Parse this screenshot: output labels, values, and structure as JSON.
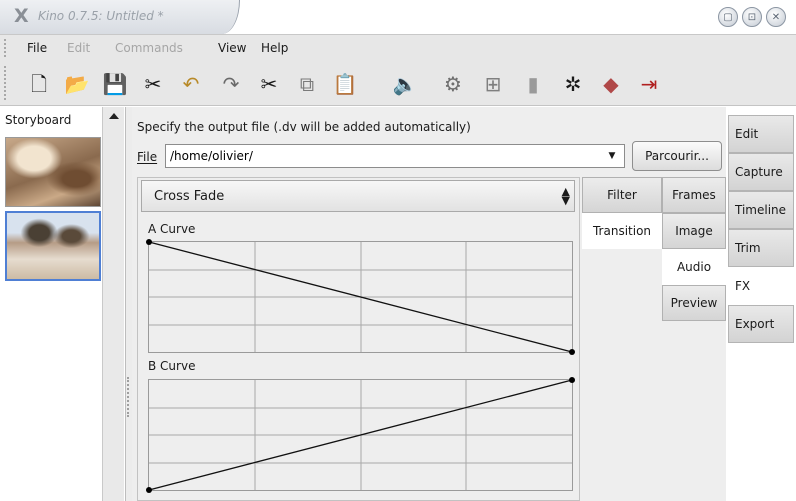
{
  "window": {
    "title": "Kino 0.7.5: Untitled *",
    "logo_glyph": "X",
    "controls": [
      {
        "name": "minimize",
        "glyph": "▢"
      },
      {
        "name": "maximize",
        "glyph": "⊡"
      },
      {
        "name": "close",
        "glyph": "✕"
      }
    ]
  },
  "menu": {
    "items": [
      {
        "label": "File",
        "enabled": true
      },
      {
        "label": "Edit",
        "enabled": false
      },
      {
        "label": "Commands",
        "enabled": false
      },
      {
        "label": "View",
        "enabled": true
      },
      {
        "label": "Help",
        "enabled": true
      }
    ]
  },
  "toolbar": {
    "icons": [
      {
        "name": "new-file-icon",
        "glyph": "🗋"
      },
      {
        "name": "open-folder-icon",
        "glyph": "📂"
      },
      {
        "name": "save-icon",
        "glyph": "💾"
      },
      {
        "name": "tools-icon",
        "glyph": "✂"
      },
      {
        "name": "undo-icon",
        "glyph": "↶"
      },
      {
        "name": "redo-icon",
        "glyph": "↷"
      },
      {
        "name": "cut-icon",
        "glyph": "✂"
      },
      {
        "name": "copy-icon",
        "glyph": "⧉"
      },
      {
        "name": "paste-icon",
        "glyph": "📋"
      },
      {
        "name": "speaker-icon",
        "glyph": "🔈"
      },
      {
        "name": "capture-icon",
        "glyph": "⚙"
      },
      {
        "name": "scene-icon",
        "glyph": "⊞"
      },
      {
        "name": "clip-icon",
        "glyph": "▮"
      },
      {
        "name": "properties-icon",
        "glyph": "✲"
      },
      {
        "name": "eraser-icon",
        "glyph": "◆"
      },
      {
        "name": "exit-icon",
        "glyph": "⇥"
      }
    ],
    "colors": {
      "save": "#4a7bb8",
      "undo": "#b88a28",
      "exit": "#b02020",
      "eraser": "#b04848"
    }
  },
  "storyboard": {
    "label": "Storyboard"
  },
  "export": {
    "hint": "Specify the output file (.dv will be added automatically)",
    "file_label": "File",
    "file_value": "/home/olivier/",
    "browse_label": "Parcourir..."
  },
  "fx": {
    "transition_selected": "Cross Fade",
    "curve_a_label": "A Curve",
    "curve_b_label": "B Curve",
    "curve_a": {
      "start": 1.0,
      "end": 0.0
    },
    "curve_b": {
      "start": 0.0,
      "end": 1.0
    },
    "inner_tabs": {
      "filter": "Filter",
      "transition": "Transition",
      "frames": "Frames",
      "image": "Image",
      "audio": "Audio",
      "preview": "Preview"
    }
  },
  "sidebar_tabs": [
    {
      "label": "Edit",
      "active": false
    },
    {
      "label": "Capture",
      "active": false
    },
    {
      "label": "Timeline",
      "active": false
    },
    {
      "label": "Trim",
      "active": false
    },
    {
      "label": "FX",
      "active": true
    },
    {
      "label": "Export",
      "active": false
    }
  ]
}
